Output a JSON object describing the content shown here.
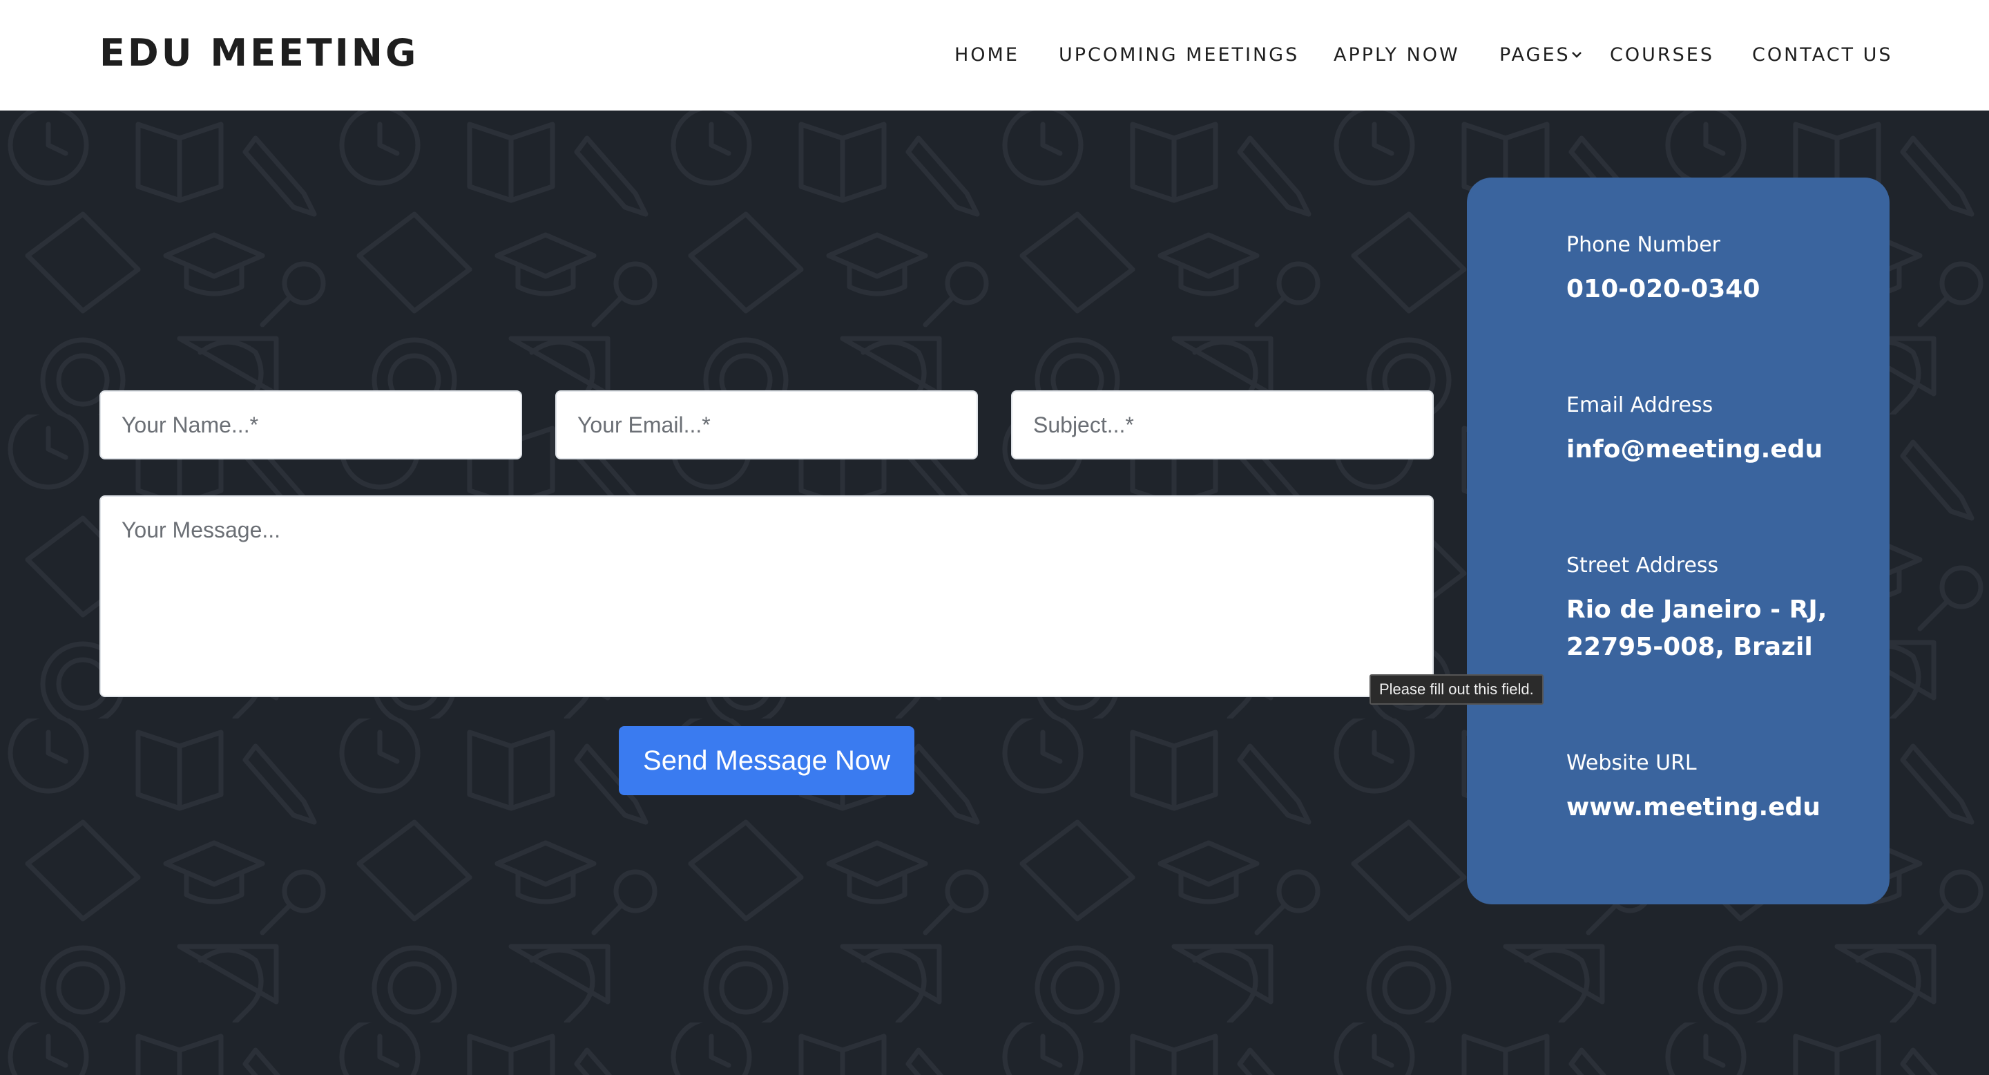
{
  "header": {
    "logo": "EDU MEETING",
    "nav": [
      {
        "label": "HOME"
      },
      {
        "label": "UPCOMING MEETINGS"
      },
      {
        "label": "APPLY NOW"
      },
      {
        "label": "PAGES",
        "icon": "chevron-down-icon"
      },
      {
        "label": "COURSES"
      },
      {
        "label": "CONTACT US"
      }
    ]
  },
  "form": {
    "name_placeholder": "Your Name...*",
    "email_placeholder": "Your Email...*",
    "subject_placeholder": "Subject...*",
    "message_placeholder": "Your Message...",
    "submit_label": "Send Message Now",
    "validation_tooltip": "Please fill out this field."
  },
  "contact_info": {
    "phone_label": "Phone Number",
    "phone_value": "010-020-0340",
    "email_label": "Email Address",
    "email_value": "info@meeting.edu",
    "address_label": "Street Address",
    "address_line1": "Rio de Janeiro - RJ,",
    "address_line2": "22795-008, Brazil",
    "website_label": "Website URL",
    "website_value": "www.meeting.edu"
  },
  "colors": {
    "page_background": "#1f242b",
    "header_background": "#ffffff",
    "card_background": "#3a649e",
    "button_background": "#3a7bf0"
  }
}
